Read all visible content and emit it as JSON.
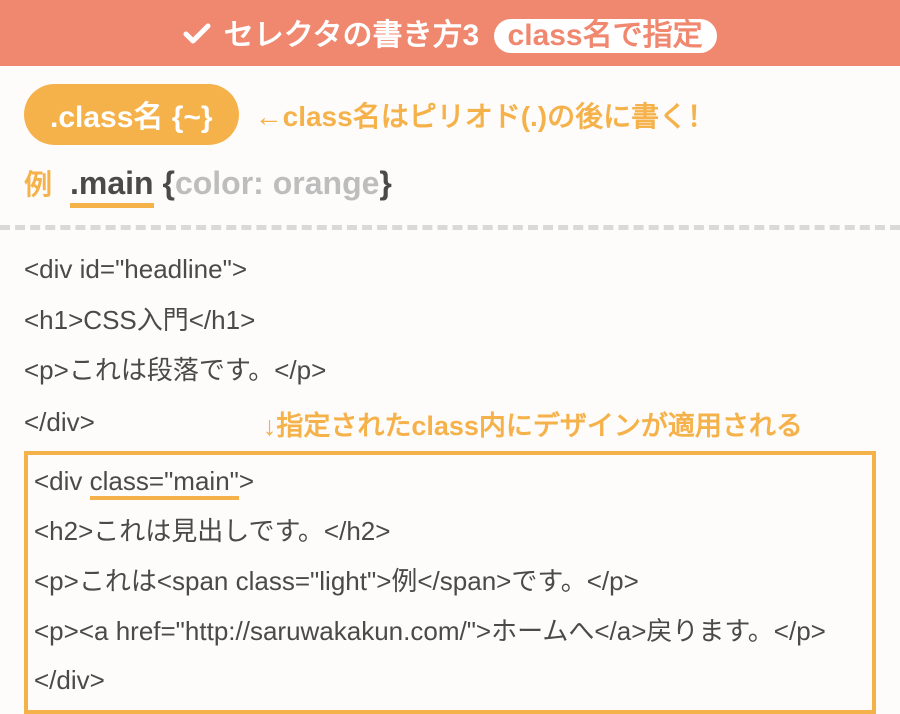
{
  "header": {
    "prefix": "セレクタの書き方",
    "number": "3",
    "highlight": "class名で指定"
  },
  "syntax": {
    "pill": ".class名 {~}",
    "note": "←class名はピリオド(.)の後に書く！"
  },
  "example": {
    "label": "例",
    "selector": ".main",
    "brace_open": "{",
    "rule": "color: orange",
    "brace_close": "}"
  },
  "code": {
    "line1": "<div id=\"headline\">",
    "line2": "<h1>CSS入門</h1>",
    "line3": "<p>これは段落です。</p>",
    "line4": "</div>",
    "annotation": "↓指定されたclass内にデザインが適用される",
    "box1_a": "<div ",
    "box1_b": "class=\"main\"",
    "box1_c": ">",
    "box2": "<h2>これは見出しです。</h2>",
    "box3": "<p>これは<span class=\"light\">例</span>です。</p>",
    "box4": "<p><a href=\"http://saruwakakun.com/\">ホームへ</a>戻ります。</p>",
    "box5": "</div>"
  }
}
